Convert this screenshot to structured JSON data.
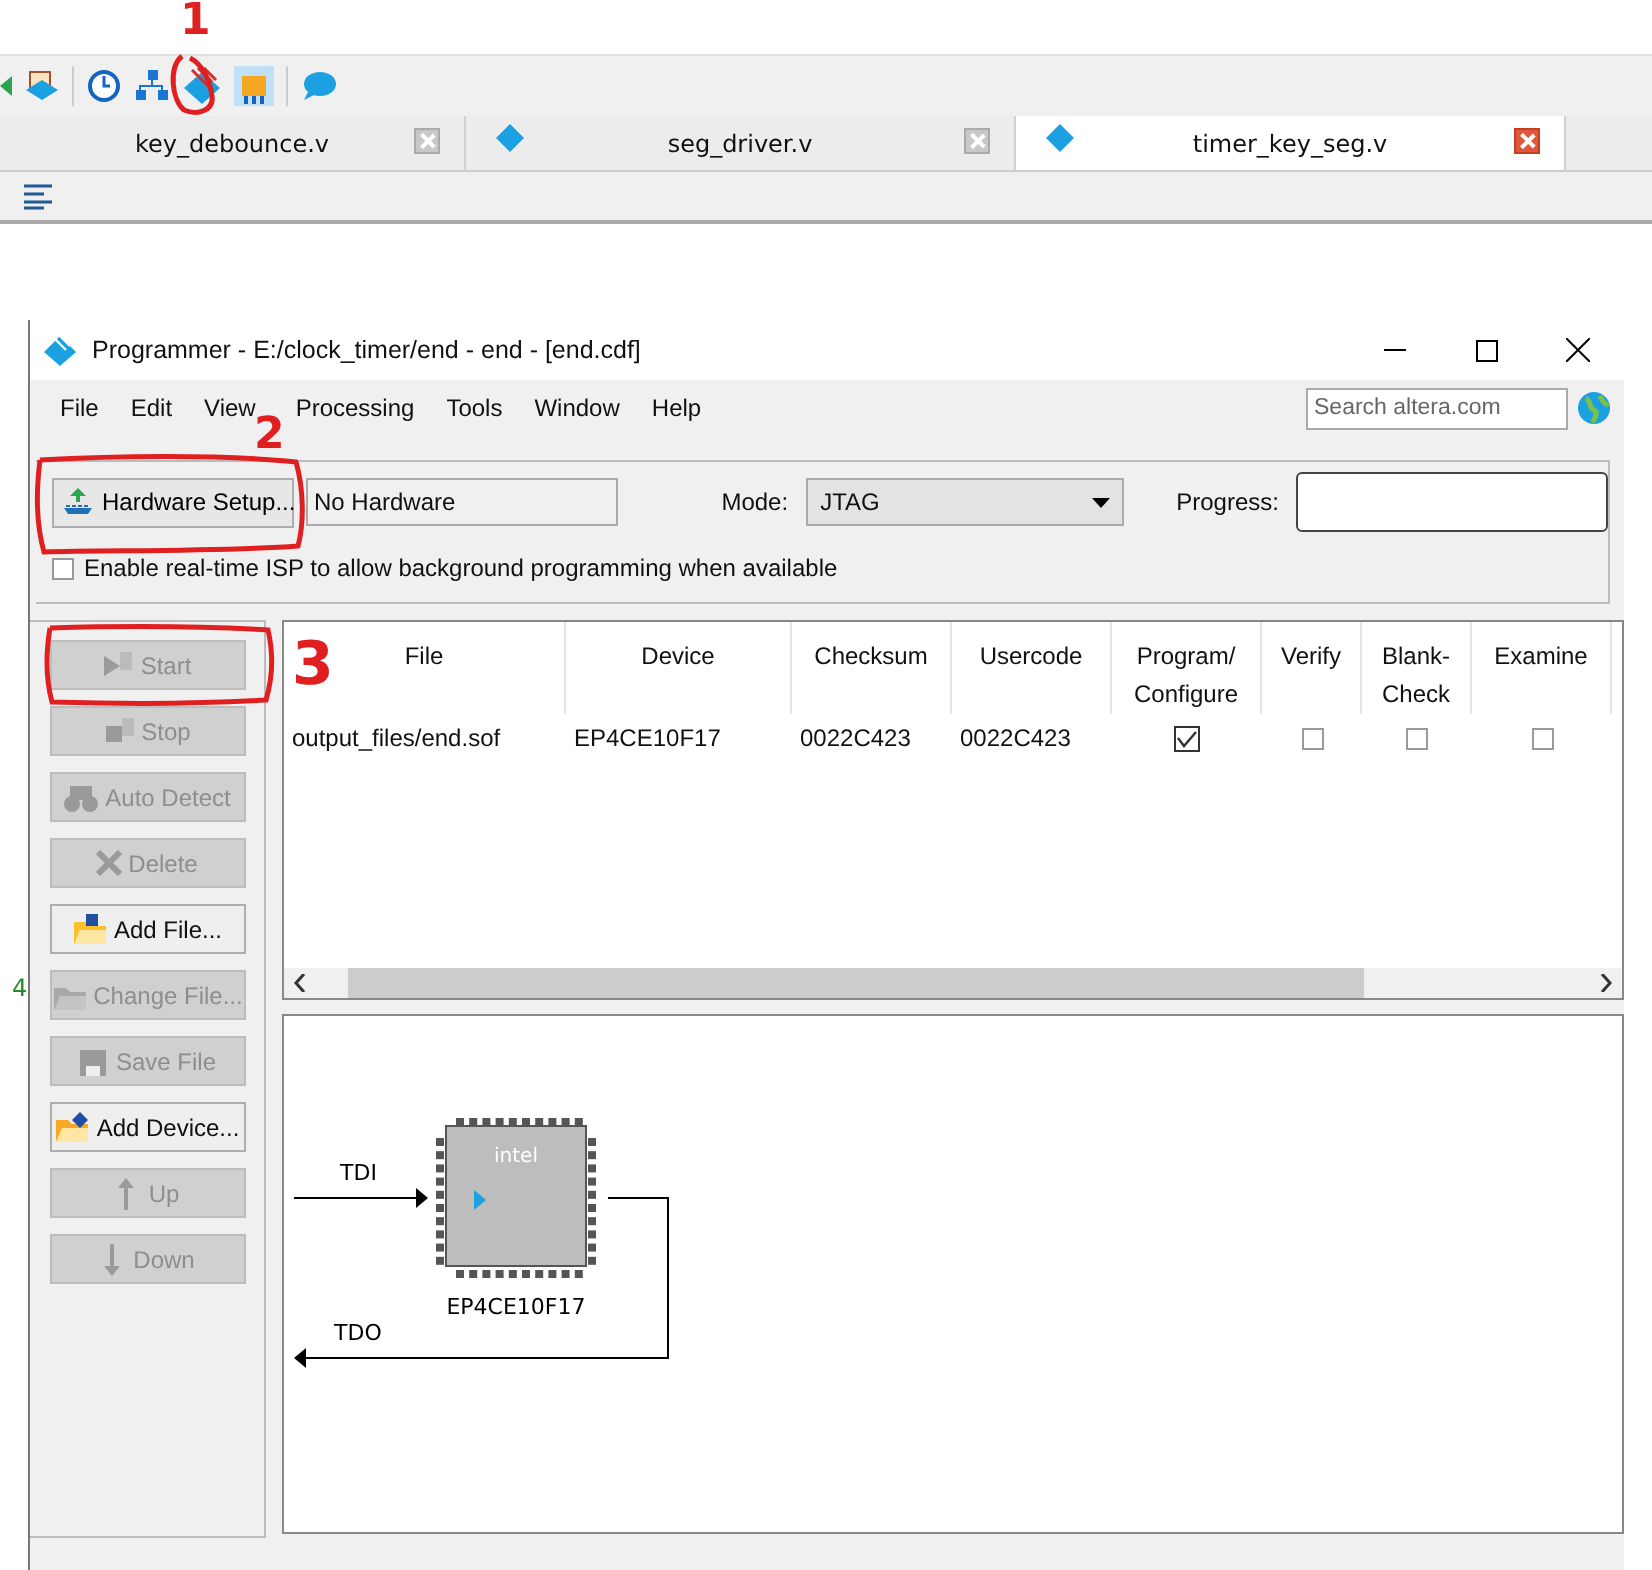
{
  "editor": {
    "tabs": [
      {
        "label": "key_debounce.v",
        "selected": false,
        "kind": "plain"
      },
      {
        "label": "seg_driver.v",
        "selected": false,
        "kind": "verilog"
      },
      {
        "label": "timer_key_seg.v",
        "selected": true,
        "kind": "verilog"
      }
    ],
    "line_number": "4"
  },
  "programmer": {
    "title": "Programmer - E:/clock_timer/end - end - [end.cdf]",
    "menu": [
      "File",
      "Edit",
      "View",
      "Processing",
      "Tools",
      "Window",
      "Help"
    ],
    "search": {
      "placeholder": "Search altera.com"
    },
    "hardware_button": "Hardware Setup...",
    "hardware_field": "No Hardware",
    "mode_label": "Mode:",
    "mode": "JTAG",
    "progress_label": "Progress:",
    "isp": {
      "label": "Enable real-time ISP to allow background programming when available",
      "checked": false
    },
    "buttons": [
      {
        "label": "Start",
        "disabled": true,
        "kind": "start"
      },
      {
        "label": "Stop",
        "disabled": true,
        "kind": "stop"
      },
      {
        "label": "Auto Detect",
        "disabled": true,
        "kind": "detect"
      },
      {
        "label": "Delete",
        "disabled": true,
        "kind": "delete"
      },
      {
        "label": "Add File...",
        "disabled": false,
        "kind": "addfile"
      },
      {
        "label": "Change File...",
        "disabled": true,
        "kind": "changefile"
      },
      {
        "label": "Save File",
        "disabled": true,
        "kind": "save"
      },
      {
        "label": "Add Device...",
        "disabled": false,
        "kind": "adddevice"
      },
      {
        "label": "Up",
        "disabled": true,
        "kind": "up"
      },
      {
        "label": "Down",
        "disabled": true,
        "kind": "down"
      }
    ],
    "table": {
      "columns": [
        "File",
        "Device",
        "Checksum",
        "Usercode",
        "Program/ Configure",
        "Verify",
        "Blank- Check",
        "Examine"
      ],
      "rows": [
        {
          "file": "output_files/end.sof",
          "device": "EP4CE10F17",
          "checksum": "0022C423",
          "usercode": "0022C423",
          "program_configure": true,
          "verify": false,
          "blank_check": false,
          "examine": false
        }
      ]
    },
    "diagram": {
      "tdi": "TDI",
      "tdo": "TDO",
      "chip_logo": "intel",
      "chip_label": "EP4CE10F17"
    }
  },
  "annotations": [
    {
      "text": "1"
    },
    {
      "text": "2"
    },
    {
      "text": "3"
    }
  ]
}
